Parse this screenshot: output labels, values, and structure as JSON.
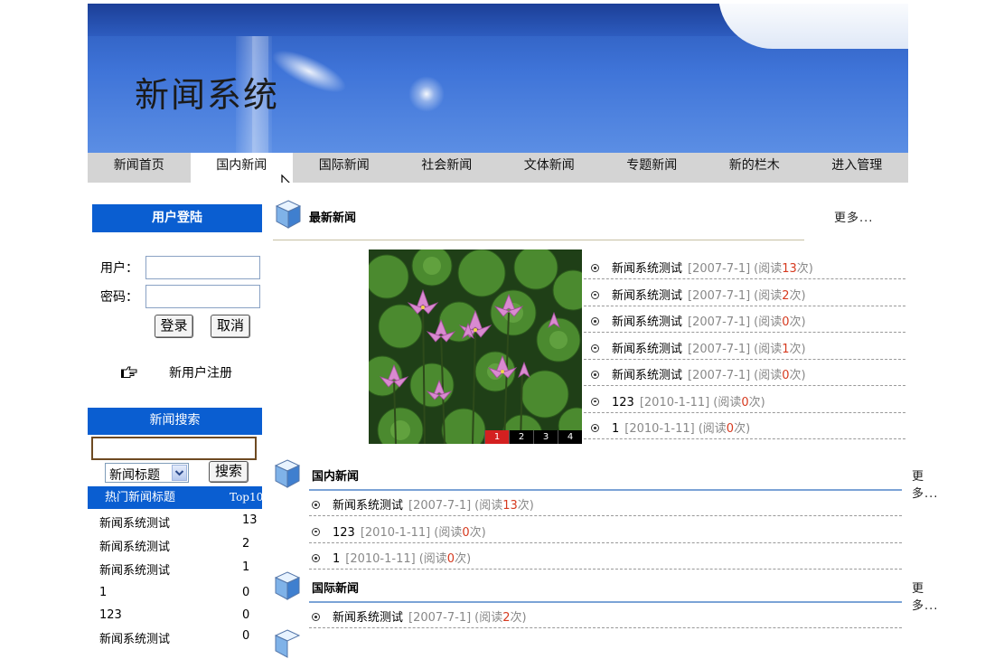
{
  "banner": {
    "title": "新闻系统"
  },
  "nav": [
    "新闻首页",
    "国内新闻",
    "国际新闻",
    "社会新闻",
    "文体新闻",
    "专题新闻",
    "新的栏木",
    "进入管理"
  ],
  "login": {
    "header": "用户登陆",
    "user_label": "用户：",
    "pass_label": "密码：",
    "user_value": "",
    "pass_value": "",
    "login_button": "登录",
    "cancel_button": "取消",
    "register_link": "新用户注册"
  },
  "search": {
    "header": "新闻搜索",
    "query": "",
    "select_value": "新闻标题",
    "button": "搜索"
  },
  "hot": {
    "header": "热门新闻标题",
    "badge": "Top10",
    "rows": [
      {
        "title": "新闻系统测试",
        "count": "13"
      },
      {
        "title": "新闻系统测试",
        "count": "2"
      },
      {
        "title": "新闻系统测试",
        "count": "1"
      },
      {
        "title": "1",
        "count": "0"
      },
      {
        "title": "123",
        "count": "0"
      },
      {
        "title": "新闻系统测试",
        "count": "0"
      }
    ]
  },
  "latest": {
    "title": "最新新闻",
    "more": "更多...",
    "pager": [
      "1",
      "2",
      "3",
      "4"
    ],
    "items": [
      {
        "title": "新闻系统测试",
        "date": "[2007-7-1]",
        "pre": "(阅读",
        "count": "13",
        "post": "次)"
      },
      {
        "title": "新闻系统测试",
        "date": "[2007-7-1]",
        "pre": "(阅读",
        "count": "2",
        "post": "次)"
      },
      {
        "title": "新闻系统测试",
        "date": "[2007-7-1]",
        "pre": "(阅读",
        "count": "0",
        "post": "次)"
      },
      {
        "title": "新闻系统测试",
        "date": "[2007-7-1]",
        "pre": "(阅读",
        "count": "1",
        "post": "次)"
      },
      {
        "title": "新闻系统测试",
        "date": "[2007-7-1]",
        "pre": "(阅读",
        "count": "0",
        "post": "次)"
      },
      {
        "title": "123",
        "date": "[2010-1-11]",
        "pre": "(阅读",
        "count": "0",
        "post": "次)"
      },
      {
        "title": "1",
        "date": "[2010-1-11]",
        "pre": "(阅读",
        "count": "0",
        "post": "次)"
      }
    ]
  },
  "domestic": {
    "title": "国内新闻",
    "more": "更多...",
    "items": [
      {
        "title": "新闻系统测试",
        "date": "[2007-7-1]",
        "pre": "(阅读",
        "count": "13",
        "post": "次)"
      },
      {
        "title": "123",
        "date": "[2010-1-11]",
        "pre": "(阅读",
        "count": "0",
        "post": "次)"
      },
      {
        "title": "1",
        "date": "[2010-1-11]",
        "pre": "(阅读",
        "count": "0",
        "post": "次)"
      }
    ]
  },
  "international": {
    "title": "国际新闻",
    "more": "更多...",
    "items": [
      {
        "title": "新闻系统测试",
        "date": "[2007-7-1]",
        "pre": "(阅读",
        "count": "2",
        "post": "次)"
      }
    ]
  },
  "colors": {
    "accent": "#0a5ed1",
    "nav_bg": "#d4d4d4",
    "count_red": "#d63a1f"
  }
}
